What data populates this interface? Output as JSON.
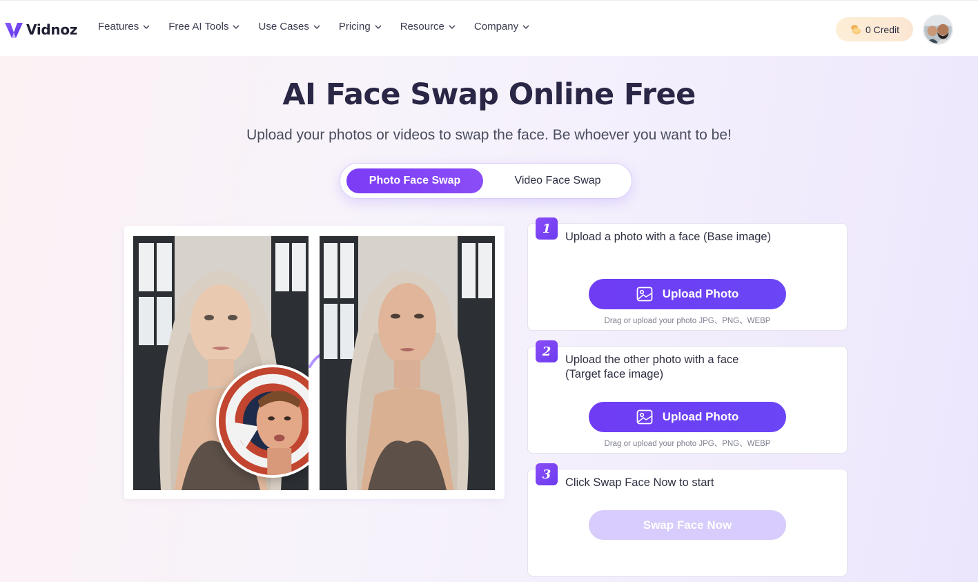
{
  "brand": {
    "name": "Vidnoz",
    "accent": "#7c3aed"
  },
  "nav": {
    "items": [
      {
        "label": "Features"
      },
      {
        "label": "Free AI Tools"
      },
      {
        "label": "Use Cases"
      },
      {
        "label": "Pricing"
      },
      {
        "label": "Resource"
      },
      {
        "label": "Company"
      }
    ],
    "credit_label": "0 Credit"
  },
  "hero": {
    "title": "AI Face Swap Online Free",
    "subtitle": "Upload your photos or videos to swap the face. Be whoever you want to be!",
    "tabs": [
      {
        "label": "Photo Face Swap",
        "active": true
      },
      {
        "label": "Video Face Swap",
        "active": false
      }
    ]
  },
  "steps": [
    {
      "number": "1",
      "text": "Upload a photo with a face (Base image)",
      "button_label": "Upload Photo",
      "hint": "Drag or upload your photo JPG、PNG、WEBP"
    },
    {
      "number": "2",
      "text": "Upload the other photo with a face (Target face image)",
      "button_label": "Upload Photo",
      "hint": "Drag or upload your photo JPG、PNG、WEBP"
    },
    {
      "number": "3",
      "text": "Click Swap Face Now to start",
      "button_label": "Swap Face Now"
    }
  ],
  "icons": {
    "nav_chevron": "chevron-down-icon",
    "credit": "coin-icon",
    "upload": "image-icon",
    "swap": "curved-arrow-icon"
  }
}
